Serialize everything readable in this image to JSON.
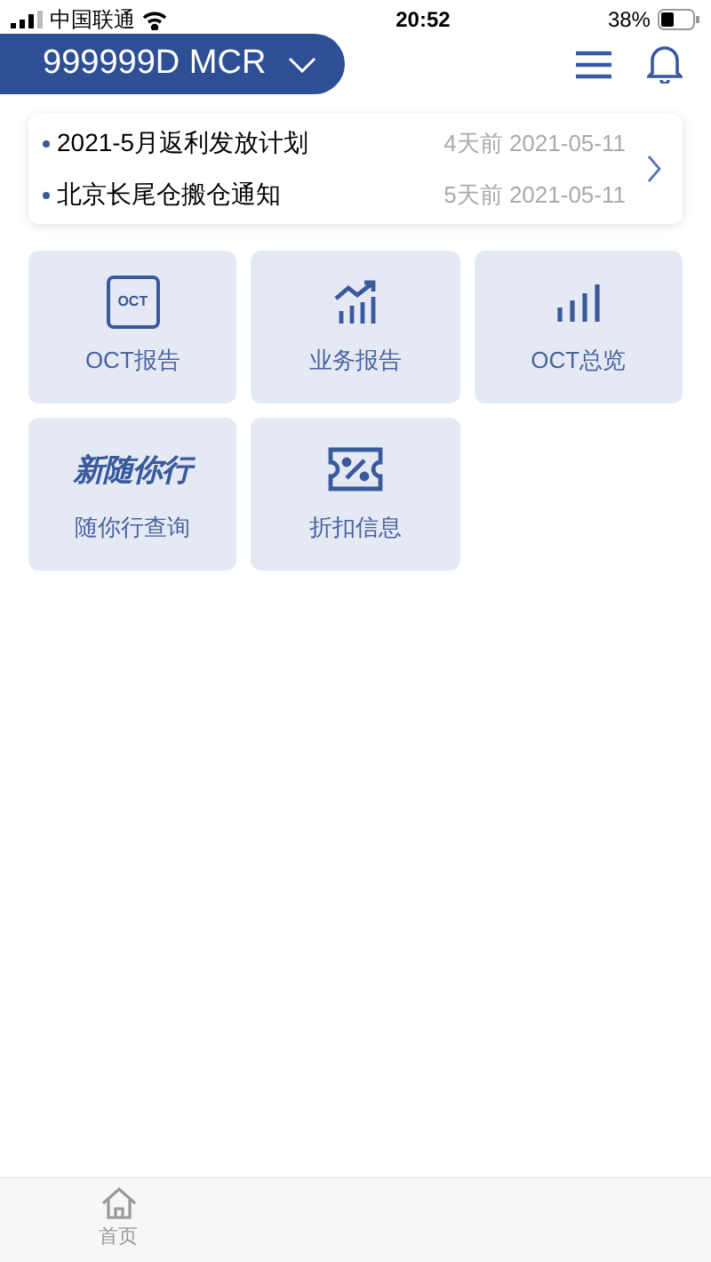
{
  "status_bar": {
    "carrier": "中国联通",
    "time": "20:52",
    "battery": "38%"
  },
  "header": {
    "account": "999999D MCR"
  },
  "notices": [
    {
      "title": "2021-5月返利发放计划",
      "ago": "4天前",
      "date": "2021-05-11"
    },
    {
      "title": "北京长尾仓搬仓通知",
      "ago": "5天前",
      "date": "2021-05-11"
    }
  ],
  "tiles": [
    {
      "kind": "oct",
      "icon_text": "OCT",
      "label": "OCT报告"
    },
    {
      "kind": "trend",
      "label": "业务报告"
    },
    {
      "kind": "bars",
      "label": "OCT总览"
    },
    {
      "kind": "logo",
      "logo_text": "新随你行",
      "label": "随你行查询"
    },
    {
      "kind": "coupon",
      "label": "折扣信息"
    }
  ],
  "tab_bar": [
    {
      "label": "首页",
      "selected": false
    }
  ]
}
